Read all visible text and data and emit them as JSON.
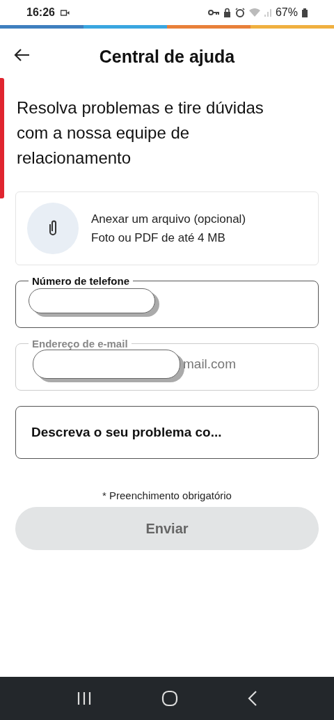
{
  "status_bar": {
    "time": "16:26",
    "battery": "67%"
  },
  "header": {
    "title": "Central de ajuda"
  },
  "intro": "Resolva problemas e tire dúvidas com a nossa equipe de relacionamento",
  "attachment": {
    "title": "Anexar um arquivo (opcional)",
    "subtitle": "Foto ou PDF de até 4 MB"
  },
  "fields": [
    {
      "kind": "phone",
      "label": "Número de telefone",
      "disabled": false
    },
    {
      "kind": "email",
      "label": "Endereço de e-mail",
      "value": "mail.com",
      "disabled": true
    },
    {
      "kind": "text",
      "value": "Descreva o seu problema co...",
      "disabled": false
    }
  ],
  "required_note": "* Preenchimento obrigatório",
  "submit": {
    "label": "Enviar",
    "disabled": true
  }
}
